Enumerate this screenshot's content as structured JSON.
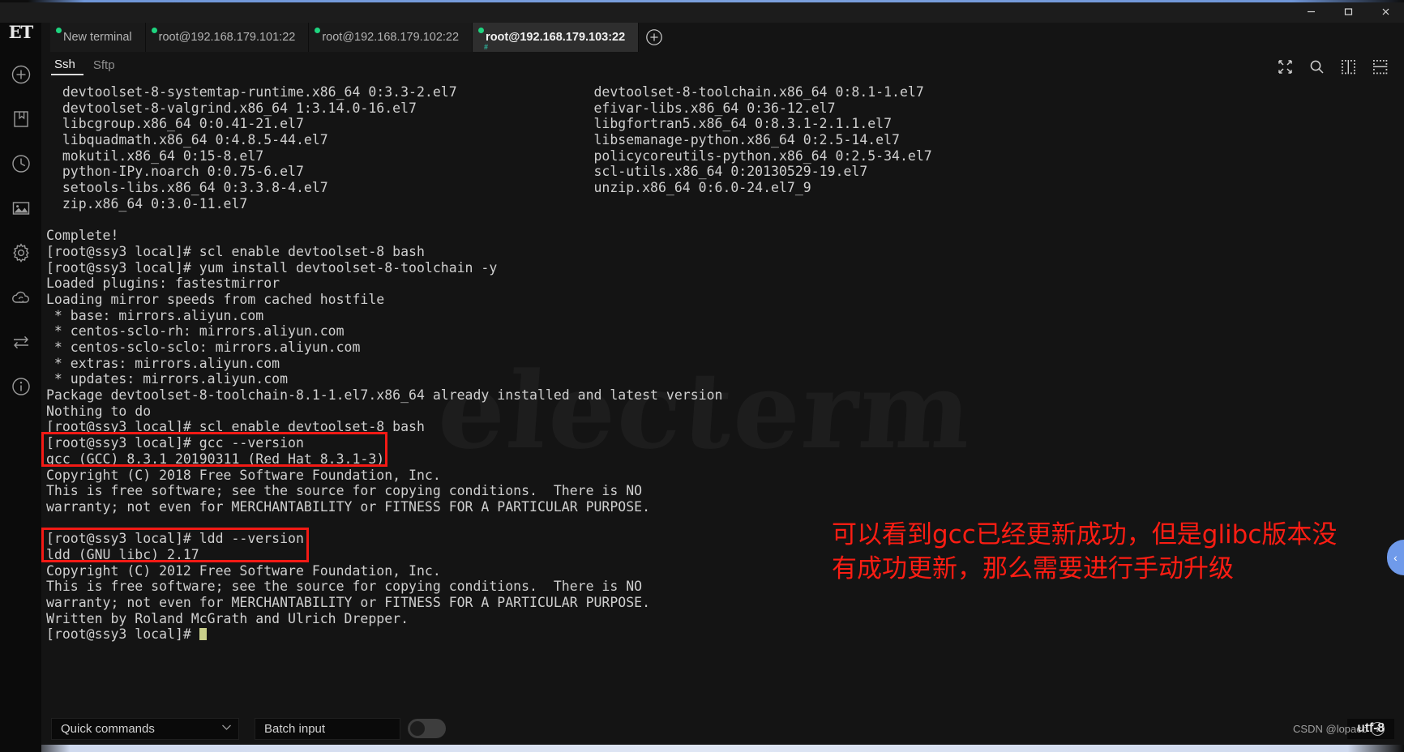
{
  "window": {
    "controls": [
      {
        "name": "minimize",
        "glyph": "–"
      },
      {
        "name": "maximize",
        "glyph": "□"
      },
      {
        "name": "close",
        "glyph": "✕"
      }
    ]
  },
  "rail": {
    "logo": "ET",
    "items": [
      {
        "name": "add-connection-icon",
        "label": "Add"
      },
      {
        "name": "bookmark-icon",
        "label": "Bookmarks"
      },
      {
        "name": "history-clock-icon",
        "label": "History"
      },
      {
        "name": "image-icon",
        "label": "Theme image"
      },
      {
        "name": "settings-gear-icon",
        "label": "Settings"
      },
      {
        "name": "cloud-sync-icon",
        "label": "Sync"
      },
      {
        "name": "transfer-icon",
        "label": "Transfers"
      },
      {
        "name": "info-icon",
        "label": "Info"
      }
    ]
  },
  "tabs": {
    "items": [
      {
        "label": "New terminal",
        "active": false
      },
      {
        "label": "root@192.168.179.101:22",
        "active": false
      },
      {
        "label": "root@192.168.179.102:22",
        "active": false
      },
      {
        "label": "root@192.168.179.103:22",
        "active": true
      }
    ],
    "add_label": "+",
    "active_hash": "#"
  },
  "subbar": {
    "tabs": [
      {
        "label": "Ssh",
        "active": true
      },
      {
        "label": "Sftp",
        "active": false
      }
    ],
    "icons": [
      {
        "name": "fullscreen-icon"
      },
      {
        "name": "search-icon"
      },
      {
        "name": "split-vertical-icon"
      },
      {
        "name": "split-horizontal-icon"
      }
    ]
  },
  "terminal": {
    "watermark": "electerm",
    "lines": [
      "  devtoolset-8-systemtap-runtime.x86_64 0:3.3-2.el7                 devtoolset-8-toolchain.x86_64 0:8.1-1.el7",
      "  devtoolset-8-valgrind.x86_64 1:3.14.0-16.el7                      efivar-libs.x86_64 0:36-12.el7",
      "  libcgroup.x86_64 0:0.41-21.el7                                    libgfortran5.x86_64 0:8.3.1-2.1.1.el7",
      "  libquadmath.x86_64 0:4.8.5-44.el7                                 libsemanage-python.x86_64 0:2.5-14.el7",
      "  mokutil.x86_64 0:15-8.el7                                         policycoreutils-python.x86_64 0:2.5-34.el7",
      "  python-IPy.noarch 0:0.75-6.el7                                    scl-utils.x86_64 0:20130529-19.el7",
      "  setools-libs.x86_64 0:3.3.8-4.el7                                 unzip.x86_64 0:6.0-24.el7_9",
      "  zip.x86_64 0:3.0-11.el7",
      "",
      "Complete!",
      "[root@ssy3 local]# scl enable devtoolset-8 bash",
      "[root@ssy3 local]# yum install devtoolset-8-toolchain -y",
      "Loaded plugins: fastestmirror",
      "Loading mirror speeds from cached hostfile",
      " * base: mirrors.aliyun.com",
      " * centos-sclo-rh: mirrors.aliyun.com",
      " * centos-sclo-sclo: mirrors.aliyun.com",
      " * extras: mirrors.aliyun.com",
      " * updates: mirrors.aliyun.com",
      "Package devtoolset-8-toolchain-8.1-1.el7.x86_64 already installed and latest version",
      "Nothing to do",
      "[root@ssy3 local]# scl enable devtoolset-8 bash",
      "[root@ssy3 local]# gcc --version",
      "gcc (GCC) 8.3.1 20190311 (Red Hat 8.3.1-3)",
      "Copyright (C) 2018 Free Software Foundation, Inc.",
      "This is free software; see the source for copying conditions.  There is NO",
      "warranty; not even for MERCHANTABILITY or FITNESS FOR A PARTICULAR PURPOSE.",
      "",
      "[root@ssy3 local]# ldd --version",
      "ldd (GNU libc) 2.17",
      "Copyright (C) 2012 Free Software Foundation, Inc.",
      "This is free software; see the source for copying conditions.  There is NO",
      "warranty; not even for MERCHANTABILITY or FITNESS FOR A PARTICULAR PURPOSE.",
      "Written by Roland McGrath and Ulrich Drepper.",
      "[root@ssy3 local]# "
    ]
  },
  "annotations": {
    "color": "#fc1d13",
    "line1": "可以看到gcc已经更新成功，但是glibc版本没",
    "line2": "有成功更新，那么需要进行手动升级",
    "boxes": [
      {
        "name": "gcc-version-highlight"
      },
      {
        "name": "ldd-version-highlight"
      }
    ]
  },
  "slide_handle": {
    "glyph": "‹"
  },
  "bottombar": {
    "quick_commands_label": "Quick commands",
    "quick_commands_chevron": "⌄",
    "batch_input_label": "Batch input",
    "encoding": "utf-8",
    "watermark": "CSDN @lopacb",
    "watermark_badge": "i"
  }
}
